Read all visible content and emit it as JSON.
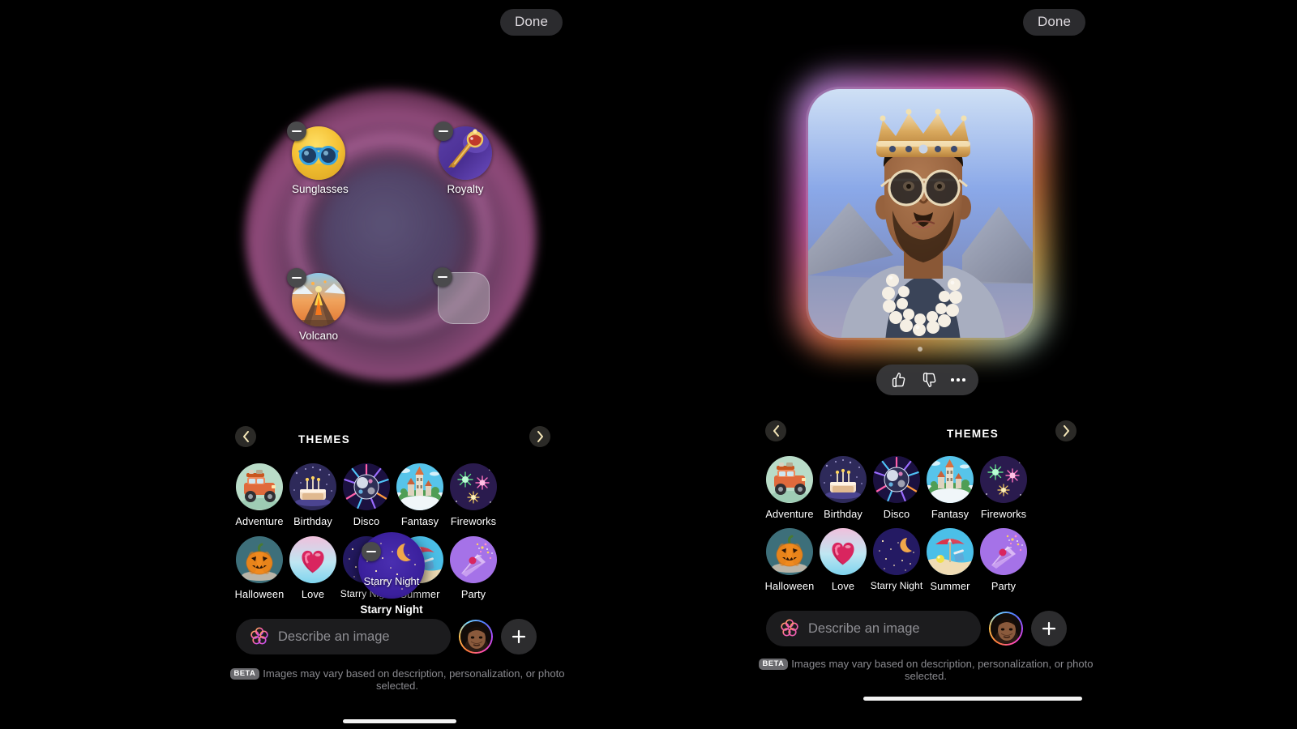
{
  "app": {
    "background": "#000000",
    "accent": "#ff6fd8"
  },
  "left_panel": {
    "done_label": "Done",
    "canvas": {
      "orb_colors": [
        "#785a8c",
        "#e878c6",
        "#d25faa"
      ],
      "chips": [
        {
          "label": "Sunglasses",
          "icon": "sunglasses-icon",
          "remove_label": "remove"
        },
        {
          "label": "Royalty",
          "icon": "scepter-icon",
          "remove_label": "remove"
        },
        {
          "label": "Volcano",
          "icon": "volcano-icon",
          "remove_label": "remove"
        },
        {
          "label": "",
          "icon": "empty-placeholder-icon",
          "remove_label": "remove"
        }
      ]
    },
    "themes": {
      "title": "THEMES",
      "prev_icon": "chevron-left-icon",
      "next_icon": "chevron-right-icon",
      "row1": [
        {
          "label": "Adventure",
          "icon": "offroad-truck-icon"
        },
        {
          "label": "Birthday",
          "icon": "birthday-cake-icon"
        },
        {
          "label": "Disco",
          "icon": "disco-ball-icon"
        },
        {
          "label": "Fantasy",
          "icon": "fantasy-castle-icon"
        },
        {
          "label": "Fireworks",
          "icon": "fireworks-icon"
        }
      ],
      "row2": [
        {
          "label": "Halloween",
          "icon": "jack-o-lantern-icon"
        },
        {
          "label": "Love",
          "icon": "heart-balloon-icon"
        },
        {
          "label": "Starry Night",
          "icon": "starry-night-icon"
        },
        {
          "label": "Summer",
          "icon": "beach-umbrella-icon"
        },
        {
          "label": "Party",
          "icon": "party-popper-icon"
        }
      ],
      "dragging": {
        "label": "Starry Night",
        "caption": "Starry Night",
        "icon": "starry-night-icon",
        "remove_label": "remove"
      }
    },
    "prompt": {
      "placeholder": "Describe an image",
      "bloom_icon": "image-playground-bloom-icon",
      "avatar_name": "person-avatar",
      "add_icon": "plus-icon"
    },
    "disclaimer": {
      "badge": "BETA",
      "text": "Images may vary based on description, personalization, or photo selected."
    }
  },
  "right_panel": {
    "done_label": "Done",
    "result": {
      "image_name": "generated-portrait-king-with-sunglasses",
      "page_indicator_dots": 1,
      "actions": [
        {
          "label": "Thumbs up",
          "icon": "thumbs-up-icon"
        },
        {
          "label": "Thumbs down",
          "icon": "thumbs-down-icon"
        },
        {
          "label": "More options",
          "icon": "ellipsis-icon"
        }
      ]
    },
    "themes": {
      "title": "THEMES",
      "prev_icon": "chevron-left-icon",
      "next_icon": "chevron-right-icon",
      "row1": [
        {
          "label": "Adventure",
          "icon": "offroad-truck-icon"
        },
        {
          "label": "Birthday",
          "icon": "birthday-cake-icon"
        },
        {
          "label": "Disco",
          "icon": "disco-ball-icon"
        },
        {
          "label": "Fantasy",
          "icon": "fantasy-castle-icon"
        },
        {
          "label": "Fireworks",
          "icon": "fireworks-icon"
        }
      ],
      "row2": [
        {
          "label": "Halloween",
          "icon": "jack-o-lantern-icon"
        },
        {
          "label": "Love",
          "icon": "heart-balloon-icon"
        },
        {
          "label": "Starry Night",
          "icon": "starry-night-icon"
        },
        {
          "label": "Summer",
          "icon": "beach-umbrella-icon"
        },
        {
          "label": "Party",
          "icon": "party-popper-icon"
        }
      ]
    },
    "prompt": {
      "placeholder": "Describe an image",
      "bloom_icon": "image-playground-bloom-icon",
      "avatar_name": "person-avatar",
      "add_icon": "plus-icon"
    },
    "disclaimer": {
      "badge": "BETA",
      "text": "Images may vary based on description, personalization, or photo selected."
    }
  }
}
